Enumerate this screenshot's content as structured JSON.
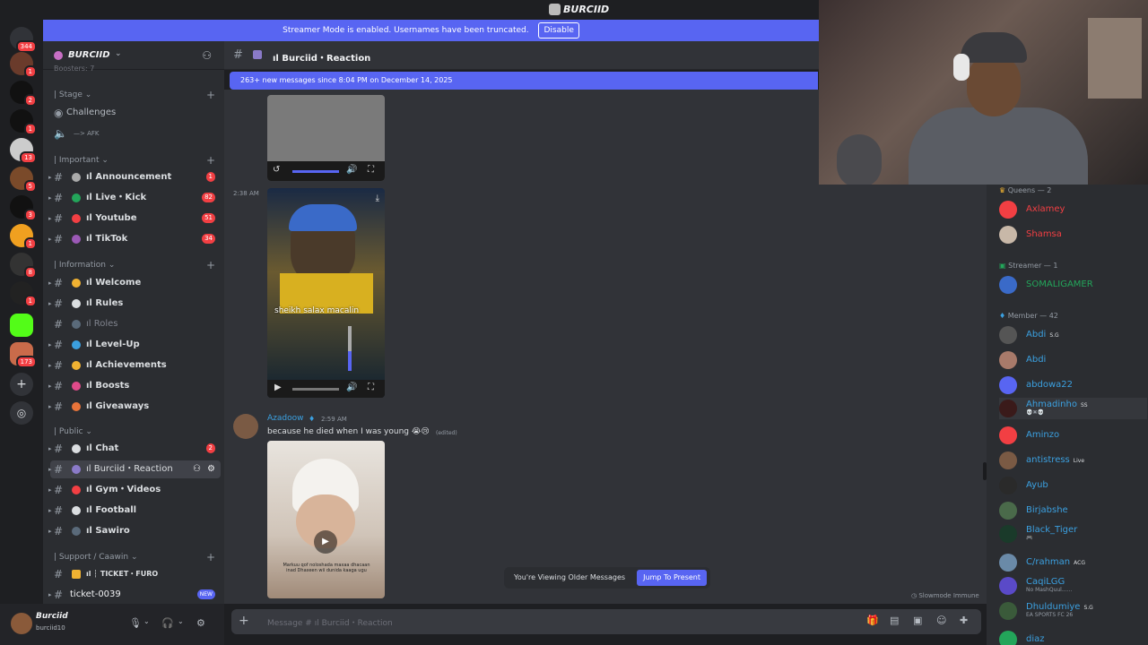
{
  "window_title": "BURCIID",
  "streamer_banner": {
    "text": "Streamer Mode is enabled. Usernames have been truncated.",
    "button": "Disable"
  },
  "server_rail": {
    "badges": [
      "344",
      "1",
      "2",
      "1",
      "13",
      "5",
      "3",
      "1",
      "8",
      "1",
      "173"
    ]
  },
  "server": {
    "name": "BURCIID"
  },
  "sidebar": {
    "truncated_top": "Boosters: 7",
    "categories": {
      "stage": "| Stage",
      "important": "| Important",
      "information": "| Information",
      "public": "| Public",
      "support": "| Support / Caawin"
    },
    "stage_items": [
      {
        "label": "Challenges"
      },
      {
        "label": "—> AFK"
      }
    ],
    "important": [
      {
        "label": "ıl Announcement",
        "count": "1"
      },
      {
        "label": "ıl Live・Kick",
        "count": "82"
      },
      {
        "label": "ıl Youtube",
        "count": "51"
      },
      {
        "label": "ıl TikTok",
        "count": "34"
      }
    ],
    "information": [
      {
        "label": "ıl Welcome"
      },
      {
        "label": "ıl Rules"
      },
      {
        "label": "ıl Roles"
      },
      {
        "label": "ıl Level-Up"
      },
      {
        "label": "ıl Achievements"
      },
      {
        "label": "ıl Boosts"
      },
      {
        "label": "ıl Giveaways"
      }
    ],
    "public": [
      {
        "label": "ıl Chat",
        "count": "2"
      },
      {
        "label": "ıl Burciid・Reaction"
      },
      {
        "label": "ıl Gym・Videos"
      },
      {
        "label": "ıl Football"
      },
      {
        "label": "ıl Sawiro"
      }
    ],
    "support": [
      {
        "label": "ıl ┆ TICKET・FURO"
      },
      {
        "label": "ticket-0039",
        "badge": "NEW"
      }
    ]
  },
  "user_panel": {
    "name": "Burciid",
    "status": "burciid10"
  },
  "channel": {
    "name": "ıl Burciid・Reaction"
  },
  "new_messages": "263+ new messages since 8:04 PM on December 14, 2025",
  "messages": [
    {
      "time": "2:38 AM",
      "video_caption": "sheikh salax macalin"
    },
    {
      "author": "Azadoow",
      "time": "2:59 AM",
      "text": "because he died when I was young 😭😢",
      "edited": "(edited)",
      "video_caption": "Markuu qof noloshada maxaa dhacaan inad Dhaxeen wii dunida kaaga ugu"
    }
  ],
  "older_bar": {
    "text": "You're Viewing Older Messages",
    "button": "Jump To Present"
  },
  "slowmode": "Slowmode Immune",
  "composer": {
    "placeholder": "Message #  ıl Burciid・Reaction"
  },
  "members": {
    "queens_header": "Queens — 2",
    "queens": [
      {
        "name": "Axlamey",
        "color": "#f23f43"
      },
      {
        "name": "Shamsa",
        "color": "#f23f43"
      }
    ],
    "streamer_header": "Streamer — 1",
    "streamers": [
      {
        "name": "SOMALIGAMER",
        "color": "#23a55a"
      }
    ],
    "member_header": "Member — 42",
    "list": [
      {
        "name": "Abdi",
        "tag": "S.G"
      },
      {
        "name": "Abdi"
      },
      {
        "name": "abdowa22"
      },
      {
        "name": "Ahmadinho",
        "tag": "SS",
        "sub": "💀✖💀"
      },
      {
        "name": "Aminzo"
      },
      {
        "name": "antistress",
        "tag": "Live"
      },
      {
        "name": "Ayub"
      },
      {
        "name": "Birjabshe"
      },
      {
        "name": "Black_Tiger",
        "sub": "🎮"
      },
      {
        "name": "C/rahman",
        "tag": "ACG"
      },
      {
        "name": "CaqiLGG",
        "sub": "No MashQuul......"
      },
      {
        "name": "Dhuldumiye",
        "tag": "S.G",
        "sub": "EA SPORTS FC 26"
      },
      {
        "name": "diaz"
      }
    ],
    "member_color": "#3ba0e0"
  }
}
